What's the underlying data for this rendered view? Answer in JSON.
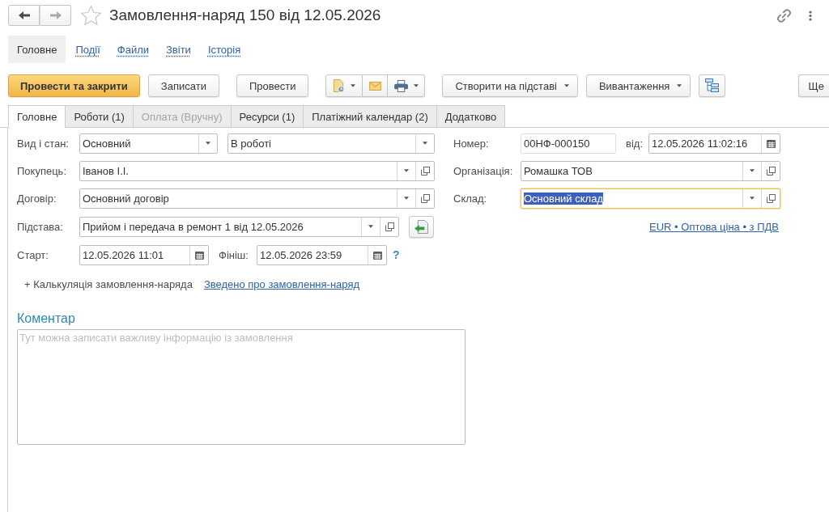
{
  "window": {
    "title": "Замовлення-наряд 150 від 12.05.2026",
    "favorite": false,
    "back_enabled": true,
    "forward_enabled": false
  },
  "sections": [
    {
      "label": "Головне",
      "selected": true
    },
    {
      "label": "Події",
      "selected": false
    },
    {
      "label": "Файли",
      "selected": false
    },
    {
      "label": "Звіти",
      "selected": false
    },
    {
      "label": "Історія",
      "selected": false
    }
  ],
  "toolbar": [
    {
      "kind": "primary",
      "label": "Провести та закрити"
    },
    {
      "kind": "button",
      "label": "Записати"
    },
    {
      "kind": "button",
      "label": "Провести"
    },
    {
      "kind": "icon-group"
    },
    {
      "kind": "menu",
      "label": "Створити на підставі"
    },
    {
      "kind": "menu",
      "label": "Вивантаження"
    },
    {
      "kind": "icon-button"
    },
    {
      "kind": "more",
      "label": "Ще"
    }
  ],
  "tabs": [
    {
      "label": "Головне",
      "selected": true,
      "disabled": false
    },
    {
      "label": "Роботи (1)",
      "selected": false,
      "disabled": false
    },
    {
      "label": "Оплата (Вручну)",
      "selected": false,
      "disabled": true
    },
    {
      "label": "Ресурси (1)",
      "selected": false,
      "disabled": false
    },
    {
      "label": "Платіжний календар (2)",
      "selected": false,
      "disabled": false
    },
    {
      "label": "Додатково",
      "selected": false,
      "disabled": false
    }
  ],
  "form": {
    "kind_and_status": {
      "label": "Вид і стан:",
      "values": [
        "Основний",
        "В роботі"
      ]
    },
    "customer": {
      "label": "Покупець:",
      "value": "Іванов І.І."
    },
    "contract": {
      "label": "Договір:",
      "value": "Основний договір"
    },
    "basis": {
      "label": "Підстава:",
      "value": "Прийом і передача в ремонт 1 від 12.05.2026"
    },
    "start": {
      "label": "Старт:",
      "value": "12.05.2026 11:01"
    },
    "finish": {
      "label": "Фініш:",
      "value": "12.05.2026 23:59"
    },
    "help": "?",
    "number": {
      "label": "Номер:",
      "value": "00НФ-000150"
    },
    "date": {
      "label": "від:",
      "value": "12.05.2026 11:02:16"
    },
    "organization": {
      "label": "Організація:",
      "value": "Ромашка ТОВ"
    },
    "warehouse": {
      "label": "Склад:",
      "value": "Основний склад",
      "focused": true,
      "value_selected": true
    },
    "price_settings_link": "EUR • Оптова ціна • з ПДВ",
    "calculation_group": "+ Калькуляція замовлення-наряда",
    "summary_link": "Зведено про замовлення-наряд"
  },
  "comment": {
    "title": "Коментар",
    "placeholder": "Тут можна записати важливу інформацію із замовлення"
  }
}
